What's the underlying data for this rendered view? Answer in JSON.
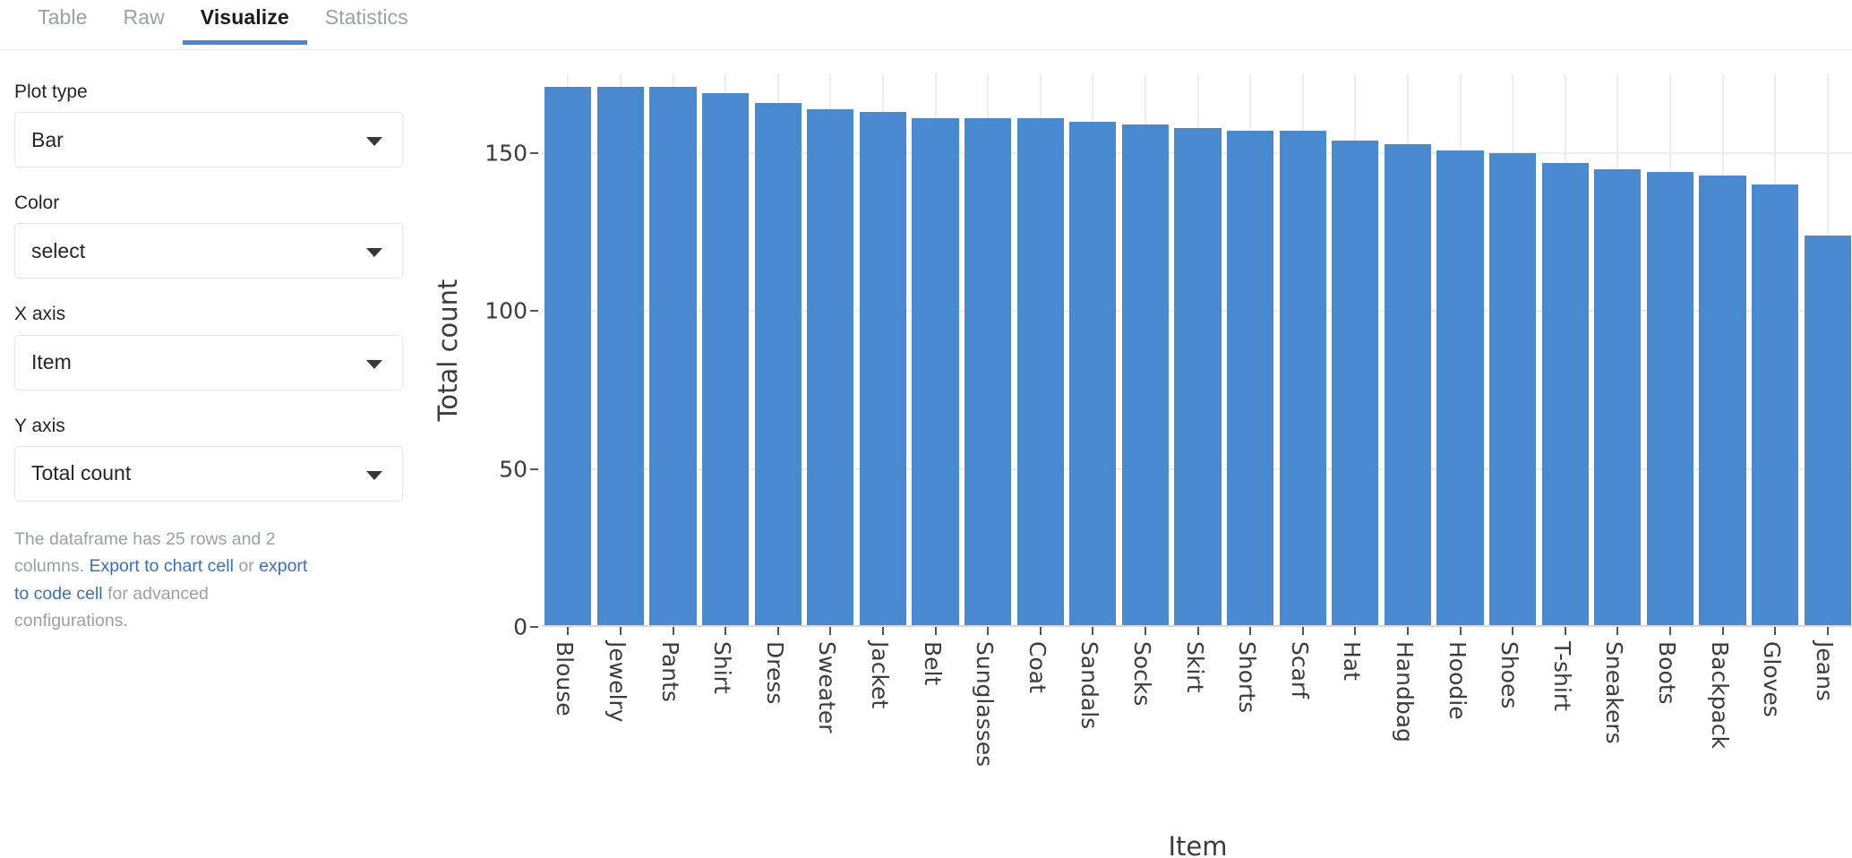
{
  "tabs": [
    {
      "label": "Table",
      "active": false
    },
    {
      "label": "Raw",
      "active": false
    },
    {
      "label": "Visualize",
      "active": true
    },
    {
      "label": "Statistics",
      "active": false
    }
  ],
  "sidebar": {
    "fields": [
      {
        "label": "Plot type",
        "value": "Bar",
        "name": "plot-type"
      },
      {
        "label": "Color",
        "value": "select",
        "name": "color"
      },
      {
        "label": "X axis",
        "value": "Item",
        "name": "x-axis"
      },
      {
        "label": "Y axis",
        "value": "Total count",
        "name": "y-axis"
      }
    ],
    "note": {
      "line1": "The dataframe has 25 rows and 2 columns.",
      "link_chart": "Export to chart cell",
      "or": " or ",
      "link_code": "export to code cell",
      "line3": "for advanced configurations."
    }
  },
  "accent_color": "#4a86d4",
  "bar_color": "#4889d0",
  "chart_data": {
    "type": "bar",
    "title": "",
    "xlabel": "Item",
    "ylabel": "Total count",
    "ylim": [
      0,
      175
    ],
    "yticks": [
      0,
      50,
      100,
      150
    ],
    "grid": true,
    "legend": false,
    "categories": [
      "Blouse",
      "Jewelry",
      "Pants",
      "Shirt",
      "Dress",
      "Sweater",
      "Jacket",
      "Belt",
      "Sunglasses",
      "Coat",
      "Sandals",
      "Socks",
      "Skirt",
      "Shorts",
      "Scarf",
      "Hat",
      "Handbag",
      "Hoodie",
      "Shoes",
      "T-shirt",
      "Sneakers",
      "Boots",
      "Backpack",
      "Gloves",
      "Jeans"
    ],
    "values": [
      171,
      171,
      171,
      169,
      166,
      164,
      163,
      161,
      161,
      161,
      160,
      159,
      158,
      157,
      157,
      154,
      153,
      151,
      150,
      147,
      145,
      144,
      143,
      140,
      124
    ]
  }
}
